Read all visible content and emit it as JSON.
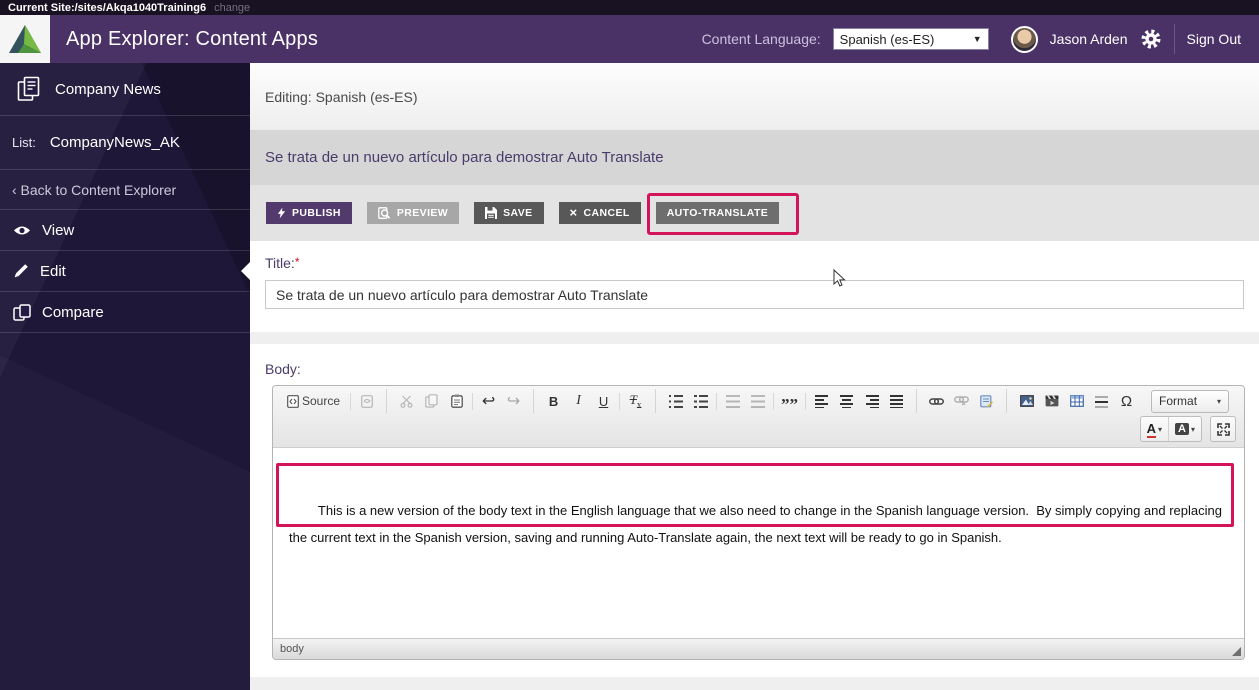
{
  "topbar": {
    "current_site_label": "Current Site:",
    "current_site_path": "/sites/Akqa1040Training6",
    "change_link": "change"
  },
  "header": {
    "app_title": "App Explorer: Content Apps",
    "content_language_label": "Content Language:",
    "language_selected": "Spanish (es-ES)",
    "user_name": "Jason Arden",
    "sign_out_label": "Sign Out"
  },
  "sidebar": {
    "app_name": "Company News",
    "list_label": "List:",
    "list_value": "CompanyNews_AK",
    "back_label": "‹ Back to Content Explorer",
    "items": [
      {
        "label": "View"
      },
      {
        "label": "Edit",
        "active": true
      },
      {
        "label": "Compare"
      }
    ]
  },
  "main": {
    "editing_label": "Editing: Spanish (es-ES)",
    "item_title": "Se trata de un nuevo artículo para demostrar Auto Translate",
    "buttons": {
      "publish": "PUBLISH",
      "preview": "PREVIEW",
      "save": "SAVE",
      "cancel": "CANCEL",
      "auto_translate": "AUTO-TRANSLATE"
    }
  },
  "form": {
    "title_label": "Title:",
    "required_marker": "*",
    "title_value": "Se trata de un nuevo artículo para demostrar Auto Translate",
    "body_label": "Body:"
  },
  "editor": {
    "source_label": "Source",
    "bold": "B",
    "italic": "I",
    "underline": "U",
    "removeformat_t": "T",
    "removeformat_x": "x",
    "quote_glyph": "””",
    "omega": "Ω",
    "format_label": "Format",
    "fontcolor_label": "A",
    "bgcolor_label": "A",
    "element_path": "body",
    "body_text": "This is a new version of the body text in the English language that we also need to change in the Spanish language version.  By simply copying and replacing the current text in the Spanish version, saving and running Auto-Translate again, the next text will be ready to go in Spanish."
  },
  "icons": {
    "caret_down": "▼",
    "caret_small": "▾",
    "cancel_x": "×",
    "undo": "↩",
    "redo": "↪"
  },
  "theme": {
    "header_purple": "#4a3166",
    "sidebar_navy": "#1f1738",
    "publish_purple": "#533a6d",
    "highlight_pink": "#d4145a",
    "label_purple": "#4a3b6b"
  }
}
